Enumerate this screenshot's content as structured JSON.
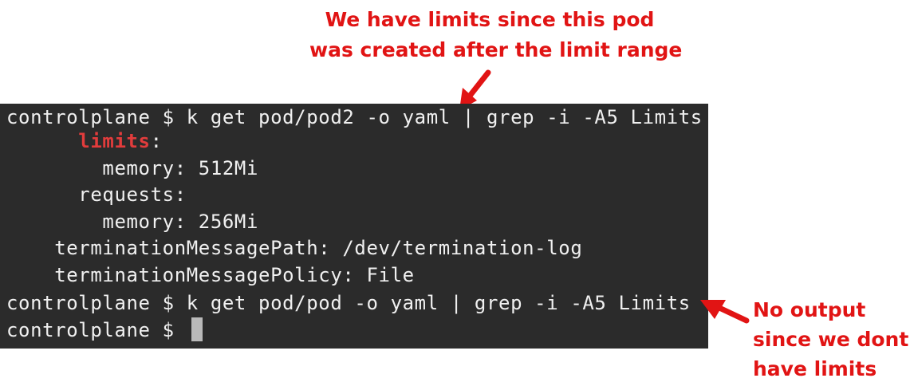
{
  "annotations": {
    "top": {
      "line1": "We have limits since this pod",
      "line2": "was created after the limit range"
    },
    "right": {
      "line1": "No output",
      "line2": "since we dont",
      "line3": "have limits"
    },
    "color": "#e11414"
  },
  "terminal": {
    "background": "#2b2b2b",
    "lines": {
      "l1": "controlplane $ k get pod/pod2 -o yaml | grep -i -A5 Limits",
      "l2_indent": "      ",
      "l2_key": "limits",
      "l2_colon": ":",
      "l3": "        memory: 512Mi",
      "l4": "      requests:",
      "l5": "        memory: 256Mi",
      "l6": "    terminationMessagePath: /dev/termination-log",
      "l7": "    terminationMessagePolicy: File",
      "l8": "controlplane $ k get pod/pod -o yaml | grep -i -A5 Limits",
      "l9": "controlplane $ "
    }
  }
}
